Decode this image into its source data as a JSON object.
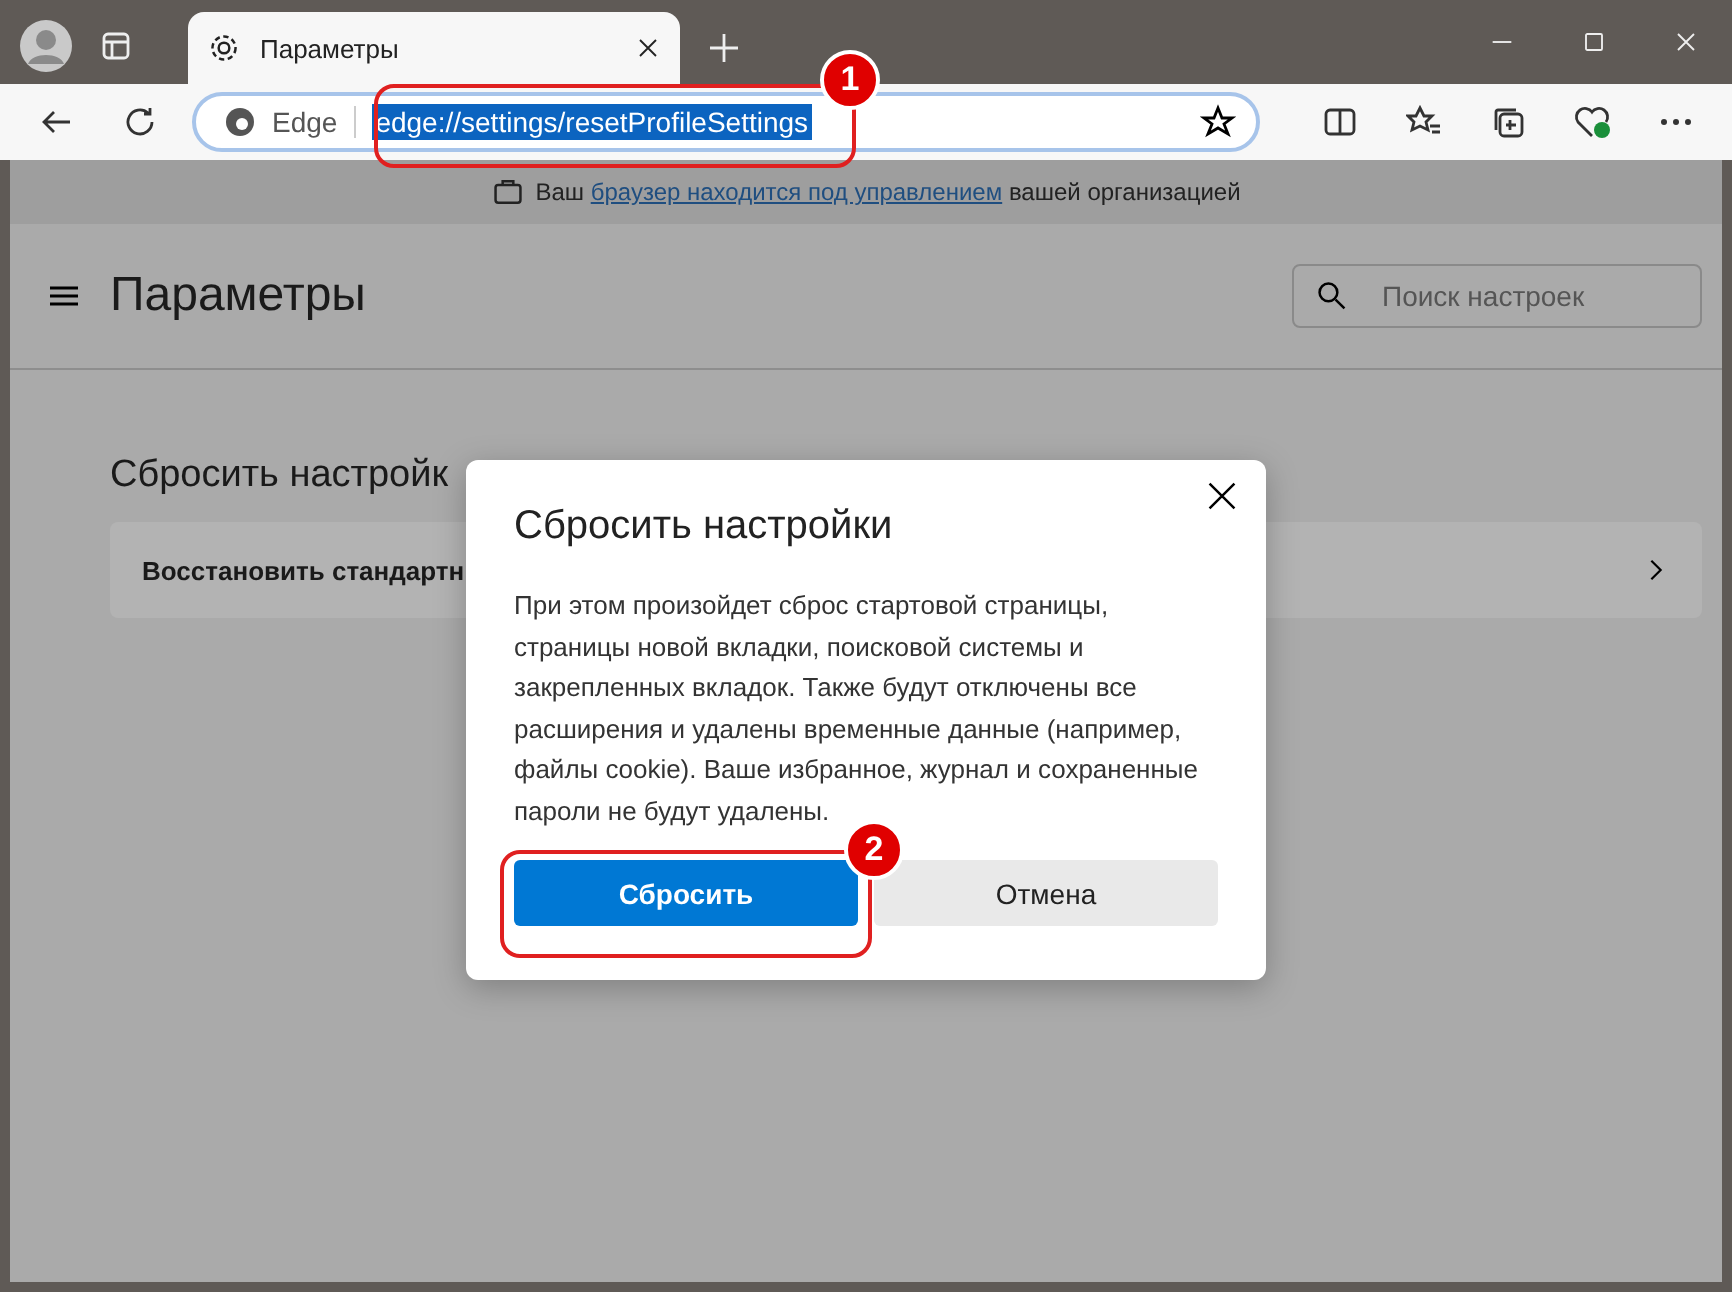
{
  "tabs": [
    {
      "title": "Параметры",
      "selected": true
    }
  ],
  "address_bar": {
    "site_label": "Edge",
    "url": "edge://settings/resetProfileSettings",
    "url_selected": true
  },
  "managed_notice": {
    "before": "Ваш",
    "link": "браузер находится под управлением",
    "after": "вашей организацией"
  },
  "settings": {
    "title": "Параметры",
    "search_placeholder": "Поиск настроек",
    "section_title": "Сбросить настройк",
    "row_label": "Восстановить стандартн"
  },
  "dialog": {
    "title": "Сбросить настройки",
    "body": "При этом произойдет сброс стартовой страницы, страницы новой вкладки, поисковой системы и закрепленных вкладок. Также будут отключены все расширения и удалены временные данные (например, файлы cookie). Ваше избранное, журнал и сохраненные пароли не будут удалены.",
    "buttons": [
      {
        "label": "Сбросить",
        "kind": "primary"
      },
      {
        "label": "Отмена",
        "kind": "secondary"
      }
    ]
  },
  "annotations": [
    {
      "number": "1"
    },
    {
      "number": "2"
    }
  ]
}
